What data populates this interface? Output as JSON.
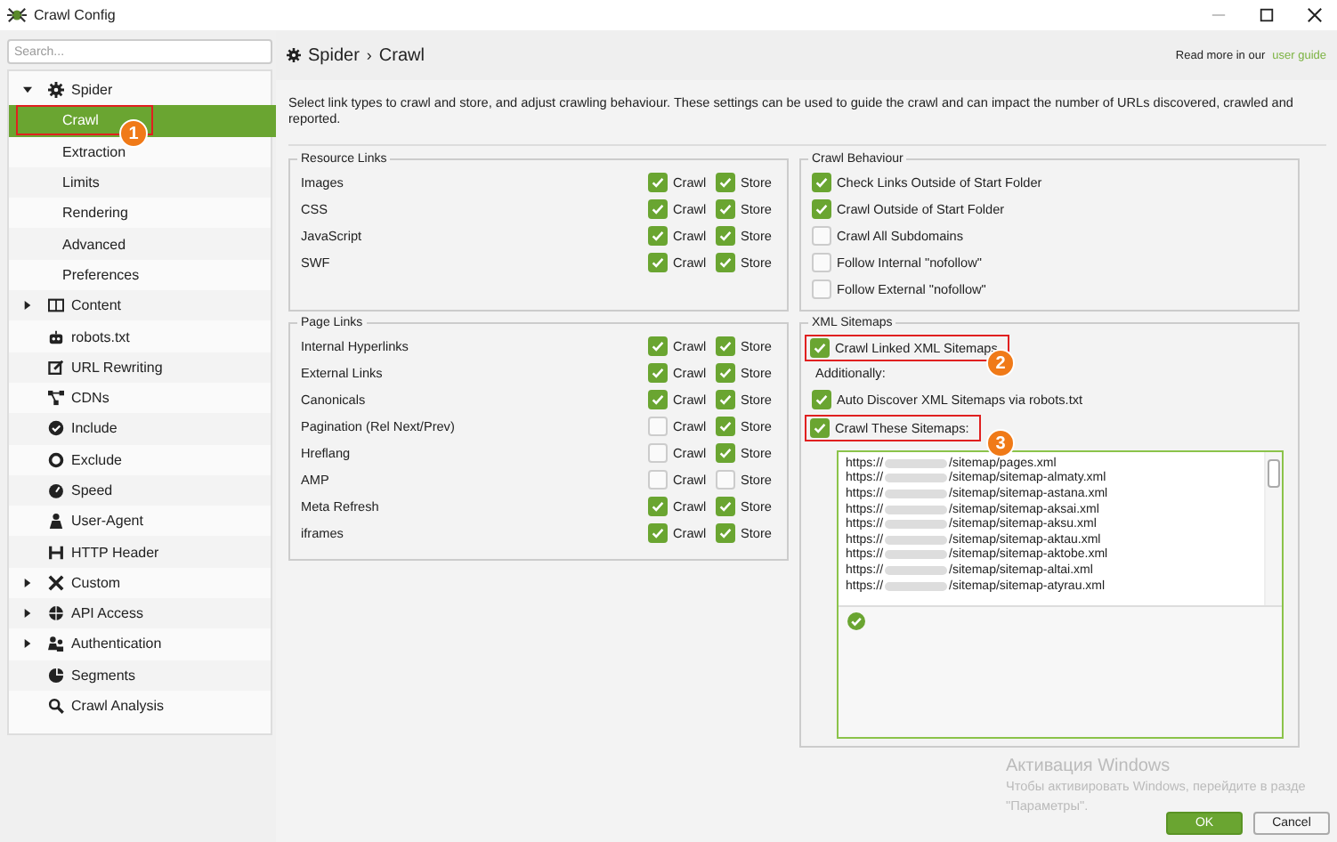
{
  "window": {
    "title": "Crawl Config"
  },
  "sidebar": {
    "search": {
      "placeholder": "Search..."
    },
    "items": [
      {
        "label": "Spider",
        "expanded": true,
        "children": [
          {
            "label": "Crawl",
            "selected": true,
            "annotation": "1"
          },
          {
            "label": "Extraction",
            "selected": false
          },
          {
            "label": "Limits",
            "selected": false
          },
          {
            "label": "Rendering",
            "selected": false
          },
          {
            "label": "Advanced",
            "selected": false
          },
          {
            "label": "Preferences",
            "selected": false
          }
        ]
      },
      {
        "label": "Content",
        "expanded": false
      },
      {
        "label": "robots.txt"
      },
      {
        "label": "URL Rewriting"
      },
      {
        "label": "CDNs"
      },
      {
        "label": "Include"
      },
      {
        "label": "Exclude"
      },
      {
        "label": "Speed"
      },
      {
        "label": "User-Agent"
      },
      {
        "label": "HTTP Header"
      },
      {
        "label": "Custom",
        "expanded": false
      },
      {
        "label": "API Access",
        "expanded": false
      },
      {
        "label": "Authentication",
        "expanded": false
      },
      {
        "label": "Segments"
      },
      {
        "label": "Crawl Analysis"
      }
    ]
  },
  "header": {
    "breadcrumb": [
      "Spider",
      "Crawl"
    ],
    "separator": "›",
    "help_text": "Read more in our",
    "help_link": "user guide"
  },
  "description": "Select link types to crawl and store, and adjust crawling behaviour. These settings can be used to guide the crawl and can impact the number of URLs discovered, crawled and reported.",
  "resource_links": {
    "title": "Resource Links",
    "rows": [
      {
        "label": "Images",
        "options": [
          {
            "label": "Crawl",
            "checked": true
          },
          {
            "label": "Store",
            "checked": true
          }
        ]
      },
      {
        "label": "CSS",
        "options": [
          {
            "label": "Crawl",
            "checked": true
          },
          {
            "label": "Store",
            "checked": true
          }
        ]
      },
      {
        "label": "JavaScript",
        "options": [
          {
            "label": "Crawl",
            "checked": true
          },
          {
            "label": "Store",
            "checked": true
          }
        ]
      },
      {
        "label": "SWF",
        "options": [
          {
            "label": "Crawl",
            "checked": true
          },
          {
            "label": "Store",
            "checked": true
          }
        ]
      }
    ]
  },
  "page_links": {
    "title": "Page Links",
    "rows": [
      {
        "label": "Internal Hyperlinks",
        "options": [
          {
            "label": "Crawl",
            "checked": true
          },
          {
            "label": "Store",
            "checked": true
          }
        ]
      },
      {
        "label": "External Links",
        "options": [
          {
            "label": "Crawl",
            "checked": true
          },
          {
            "label": "Store",
            "checked": true
          }
        ]
      },
      {
        "label": "Canonicals",
        "options": [
          {
            "label": "Crawl",
            "checked": true
          },
          {
            "label": "Store",
            "checked": true
          }
        ]
      },
      {
        "label": "Pagination (Rel Next/Prev)",
        "options": [
          {
            "label": "Crawl",
            "checked": false
          },
          {
            "label": "Store",
            "checked": true
          }
        ]
      },
      {
        "label": "Hreflang",
        "options": [
          {
            "label": "Crawl",
            "checked": false
          },
          {
            "label": "Store",
            "checked": true
          }
        ]
      },
      {
        "label": "AMP",
        "options": [
          {
            "label": "Crawl",
            "checked": false
          },
          {
            "label": "Store",
            "checked": false
          }
        ]
      },
      {
        "label": "Meta Refresh",
        "options": [
          {
            "label": "Crawl",
            "checked": true
          },
          {
            "label": "Store",
            "checked": true
          }
        ]
      },
      {
        "label": "iframes",
        "options": [
          {
            "label": "Crawl",
            "checked": true
          },
          {
            "label": "Store",
            "checked": true
          }
        ]
      }
    ]
  },
  "crawl_behaviour": {
    "title": "Crawl Behaviour",
    "options": [
      {
        "label": "Check Links Outside of Start Folder",
        "checked": true
      },
      {
        "label": "Crawl Outside of Start Folder",
        "checked": true
      },
      {
        "label": "Crawl All Subdomains",
        "checked": false
      },
      {
        "label": "Follow Internal \"nofollow\"",
        "checked": false
      },
      {
        "label": "Follow External \"nofollow\"",
        "checked": false
      }
    ]
  },
  "xml_sitemaps": {
    "title": "XML Sitemaps",
    "items": [
      {
        "kind": "checkbox",
        "label": "Crawl Linked XML Sitemaps",
        "checked": true,
        "annotation": "2"
      },
      {
        "kind": "note",
        "label": "Additionally:"
      },
      {
        "kind": "checkbox",
        "label": "Auto Discover XML Sitemaps via robots.txt",
        "checked": true
      },
      {
        "kind": "checkbox",
        "label": "Crawl These Sitemaps:",
        "checked": true,
        "annotation": "3"
      }
    ],
    "sitemap_list": {
      "valid": true,
      "urls": [
        {
          "scheme": "https://",
          "path": "/sitemap/pages.xml"
        },
        {
          "scheme": "https://",
          "path": "/sitemap/sitemap-almaty.xml"
        },
        {
          "scheme": "https://",
          "path": "/sitemap/sitemap-astana.xml"
        },
        {
          "scheme": "https://",
          "path": "/sitemap/sitemap-aksai.xml"
        },
        {
          "scheme": "https://",
          "path": "/sitemap/sitemap-aksu.xml"
        },
        {
          "scheme": "https://",
          "path": "/sitemap/sitemap-aktau.xml"
        },
        {
          "scheme": "https://",
          "path": "/sitemap/sitemap-aktobe.xml"
        },
        {
          "scheme": "https://",
          "path": "/sitemap/sitemap-altai.xml"
        },
        {
          "scheme": "https://",
          "path": "/sitemap/sitemap-atyrau.xml"
        }
      ]
    }
  },
  "os_notice": {
    "title": "Активация Windows",
    "lines": [
      "Чтобы активировать Windows, перейдите в разде",
      "\"Параметры\"."
    ]
  },
  "buttons": [
    {
      "label": "OK",
      "kind": "primary"
    },
    {
      "label": "Cancel",
      "kind": "secondary"
    }
  ]
}
